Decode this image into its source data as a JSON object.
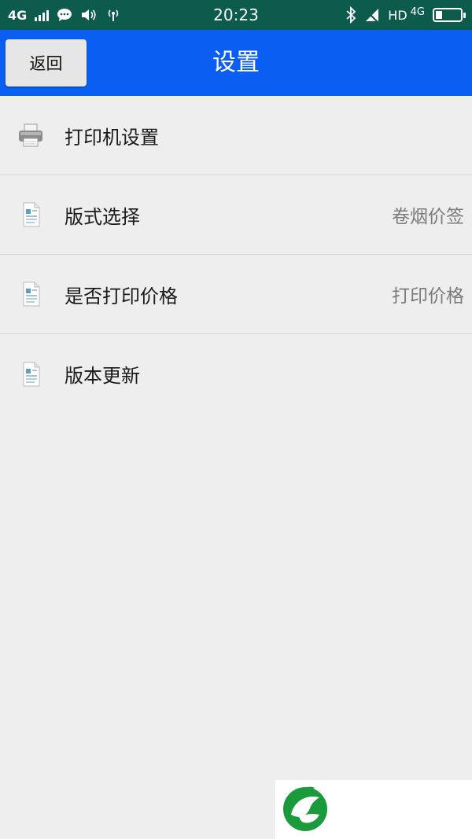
{
  "status_bar": {
    "network": "4G",
    "time": "20:23",
    "hd": "HD",
    "network_right": "4G"
  },
  "header": {
    "back_label": "返回",
    "title": "设置"
  },
  "settings": [
    {
      "label": "打印机设置",
      "value": "",
      "icon": "printer-icon"
    },
    {
      "label": "版式选择",
      "value": "卷烟价签",
      "icon": "document-icon"
    },
    {
      "label": "是否打印价格",
      "value": "打印价格",
      "icon": "document-icon"
    },
    {
      "label": "版本更新",
      "value": "",
      "icon": "document-icon"
    }
  ],
  "colors": {
    "status_bar": "#0d5b4c",
    "header": "#0a5ff2",
    "background": "#efeeee",
    "logo_green": "#1a9a3a"
  }
}
